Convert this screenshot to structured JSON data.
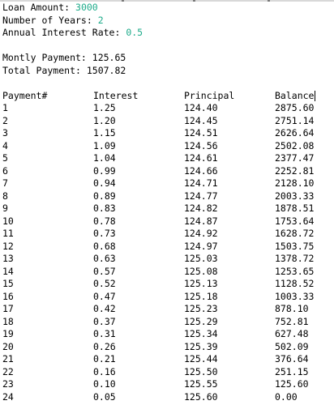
{
  "input": {
    "loan_amount_label": "Loan Amount: ",
    "loan_amount_value": "3000",
    "years_label": "Number of Years: ",
    "years_value": "2",
    "rate_label": "Annual Interest Rate: ",
    "rate_value": "0.5",
    "value_color": "#1dab8a"
  },
  "summary": {
    "monthly_payment": "Montly Payment: 125.65",
    "total_payment": "Total Payment: 1507.82"
  },
  "table": {
    "headers": [
      "Payment#",
      "Interest",
      "Principal",
      "Balance"
    ],
    "rows": [
      [
        "1",
        "1.25",
        "124.40",
        "2875.60"
      ],
      [
        "2",
        "1.20",
        "124.45",
        "2751.14"
      ],
      [
        "3",
        "1.15",
        "124.51",
        "2626.64"
      ],
      [
        "4",
        "1.09",
        "124.56",
        "2502.08"
      ],
      [
        "5",
        "1.04",
        "124.61",
        "2377.47"
      ],
      [
        "6",
        "0.99",
        "124.66",
        "2252.81"
      ],
      [
        "7",
        "0.94",
        "124.71",
        "2128.10"
      ],
      [
        "8",
        "0.89",
        "124.77",
        "2003.33"
      ],
      [
        "9",
        "0.83",
        "124.82",
        "1878.51"
      ],
      [
        "10",
        "0.78",
        "124.87",
        "1753.64"
      ],
      [
        "11",
        "0.73",
        "124.92",
        "1628.72"
      ],
      [
        "12",
        "0.68",
        "124.97",
        "1503.75"
      ],
      [
        "13",
        "0.63",
        "125.03",
        "1378.72"
      ],
      [
        "14",
        "0.57",
        "125.08",
        "1253.65"
      ],
      [
        "15",
        "0.52",
        "125.13",
        "1128.52"
      ],
      [
        "16",
        "0.47",
        "125.18",
        "1003.33"
      ],
      [
        "17",
        "0.42",
        "125.23",
        "878.10"
      ],
      [
        "18",
        "0.37",
        "125.29",
        "752.81"
      ],
      [
        "19",
        "0.31",
        "125.34",
        "627.48"
      ],
      [
        "20",
        "0.26",
        "125.39",
        "502.09"
      ],
      [
        "21",
        "0.21",
        "125.44",
        "376.64"
      ],
      [
        "22",
        "0.16",
        "125.50",
        "251.15"
      ],
      [
        "23",
        "0.10",
        "125.55",
        "125.60"
      ],
      [
        "24",
        "0.05",
        "125.60",
        "0.00"
      ]
    ]
  }
}
